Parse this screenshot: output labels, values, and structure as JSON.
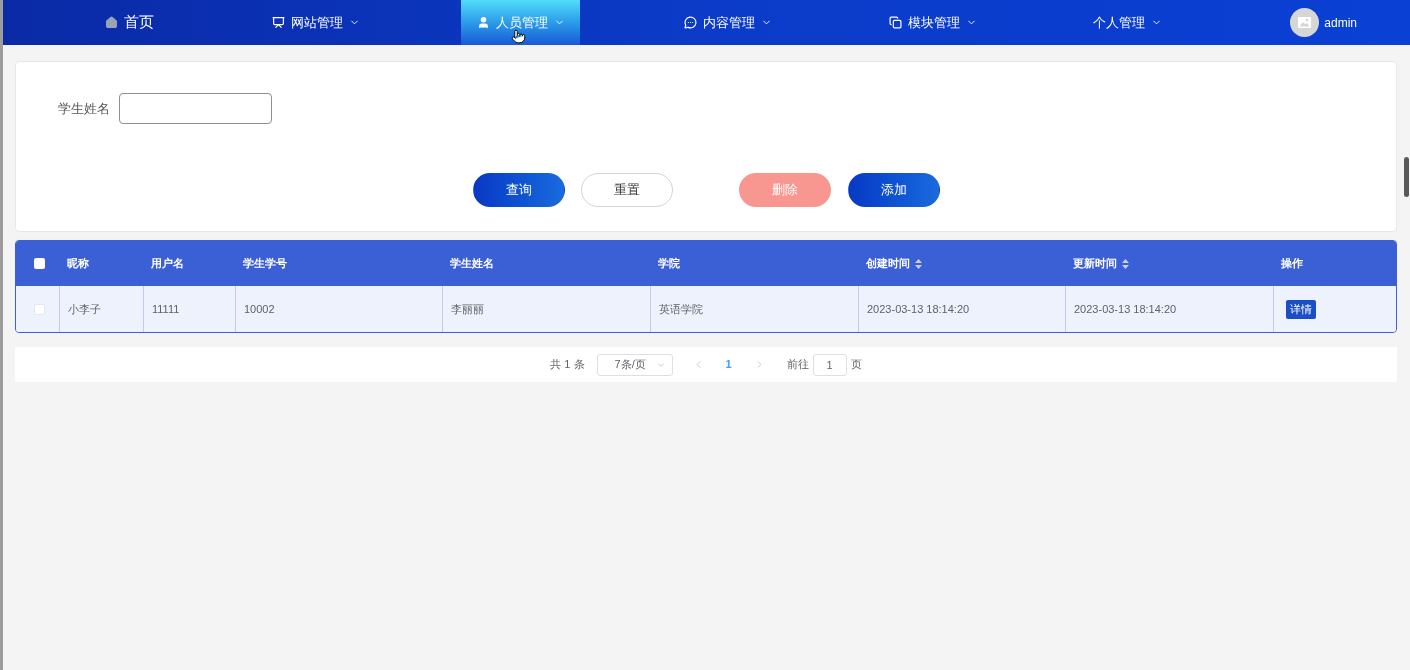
{
  "nav": {
    "items": [
      {
        "label": "首页",
        "kind": "home",
        "selected": false
      },
      {
        "label": "网站管理",
        "kind": "menu",
        "selected": false
      },
      {
        "label": "人员管理",
        "kind": "menu",
        "selected": true
      },
      {
        "label": "内容管理",
        "kind": "menu",
        "selected": false
      },
      {
        "label": "模块管理",
        "kind": "menu",
        "selected": false
      },
      {
        "label": "个人管理",
        "kind": "menu",
        "selected": false
      }
    ],
    "user": {
      "name": "admin"
    }
  },
  "search": {
    "fields": [
      {
        "label": "学生姓名"
      }
    ],
    "buttons": [
      {
        "label": "查询",
        "kind": "primary",
        "disabled": false
      },
      {
        "label": "重置",
        "kind": "default",
        "disabled": false
      }
    ]
  },
  "actions": [
    {
      "label": "删除",
      "kind": "danger",
      "disabled": true
    },
    {
      "label": "添加",
      "kind": "primary",
      "disabled": false
    }
  ],
  "table": {
    "all_checked": false,
    "columns": [
      {
        "label": "昵称",
        "sortable": false
      },
      {
        "label": "用户名",
        "sortable": false
      },
      {
        "label": "学生学号",
        "sortable": false
      },
      {
        "label": "学生姓名",
        "sortable": false
      },
      {
        "label": "学院",
        "sortable": false
      },
      {
        "label": "创建时间",
        "sortable": true
      },
      {
        "label": "更新时间",
        "sortable": true
      },
      {
        "label": "操作",
        "sortable": false
      }
    ],
    "rows": [
      {
        "checked": false,
        "cells": [
          "小李子",
          "11111",
          "10002",
          "李丽丽",
          "英语学院",
          "2023-03-13 18:14:20",
          "2023-03-13 18:14:20"
        ],
        "actions": [
          {
            "label": "详情"
          }
        ]
      }
    ]
  },
  "pagination": {
    "total": "共 1 条",
    "page_size": "7条/页",
    "pages": [
      {
        "label": "1",
        "selected": true
      }
    ],
    "goto_label": "前往",
    "goto_value": "1",
    "goto_suffix": "页"
  }
}
